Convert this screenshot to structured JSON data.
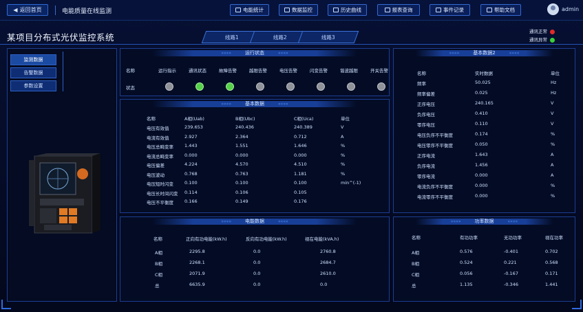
{
  "topbar": {
    "back": "返回首页",
    "title": "电能质量在线监测",
    "nav": [
      "电能统计",
      "数据监控",
      "历史曲线",
      "报表查询",
      "事件记录",
      "帮助文档"
    ],
    "user": "admin"
  },
  "system": {
    "title": "某项目分布式光伏监控系统",
    "tabs": [
      "线路1",
      "线路2",
      "线路3"
    ],
    "legend": [
      {
        "label": "通讯正常",
        "color": "#e52a2a"
      },
      {
        "label": "通讯异常",
        "color": "#3ad13a"
      }
    ]
  },
  "sidebar": {
    "buttons": [
      "监测数据",
      "告警数据",
      "参数设置"
    ]
  },
  "status": {
    "title": "运行状态",
    "row_label": "名称",
    "state_label": "状态",
    "cols": [
      "运行指示",
      "通讯状态",
      "故障告警",
      "越限告警",
      "电压告警",
      "闪变告警",
      "谐波越限",
      "开关告警"
    ],
    "states": [
      false,
      true,
      true,
      false,
      false,
      false,
      false,
      false
    ]
  },
  "basic": {
    "title": "基本数据",
    "headers": [
      "名称",
      "A相(Uab)",
      "B相(Ubc)",
      "C相(Uca)",
      "单位"
    ],
    "rows": [
      [
        "电压有效值",
        "239.653",
        "240.436",
        "240.389",
        "V"
      ],
      [
        "电流有效值",
        "2.927",
        "2.364",
        "0.712",
        "A"
      ],
      [
        "电压总畸变率",
        "1.443",
        "1.551",
        "1.646",
        "%"
      ],
      [
        "电流总畸变率",
        "0.000",
        "0.000",
        "0.000",
        "%"
      ],
      [
        "电压偏差",
        "4.224",
        "4.570",
        "4.510",
        "%"
      ],
      [
        "电压波动",
        "0.768",
        "0.763",
        "1.181",
        "%"
      ],
      [
        "电压短时闪变",
        "0.100",
        "0.100",
        "0.100",
        "min^(-1)"
      ],
      [
        "电压长时间闪变",
        "0.114",
        "0.106",
        "0.105",
        ""
      ],
      [
        "电压不平衡度",
        "0.166",
        "0.149",
        "0.176",
        ""
      ]
    ]
  },
  "right": {
    "title": "基本数据2",
    "headers": [
      "名称",
      "实时数据",
      "单位"
    ],
    "rows": [
      [
        "频率",
        "50.025",
        "Hz"
      ],
      [
        "频率偏差",
        "0.025",
        "Hz"
      ],
      [
        "正序电压",
        "240.165",
        "V"
      ],
      [
        "负序电压",
        "0.410",
        "V"
      ],
      [
        "零序电压",
        "0.110",
        "V"
      ],
      [
        "电压负序不平衡度",
        "0.174",
        "%"
      ],
      [
        "电压零序不平衡度",
        "0.050",
        "%"
      ],
      [
        "正序电流",
        "1.643",
        "A"
      ],
      [
        "负序电流",
        "1.456",
        "A"
      ],
      [
        "零序电流",
        "0.000",
        "A"
      ],
      [
        "电流负序不平衡度",
        "0.000",
        "%"
      ],
      [
        "电流零序不平衡度",
        "0.000",
        "%"
      ]
    ]
  },
  "energy": {
    "title": "电能数据",
    "headers": [
      "名称",
      "正向有功电能(kW.h)",
      "反向有功电能(kW.h)",
      "视在电能(kVA.h)"
    ],
    "rows": [
      [
        "A相",
        "2295.8",
        "0.0",
        "2760.8"
      ],
      [
        "B相",
        "2268.1",
        "0.0",
        "2684.7"
      ],
      [
        "C相",
        "2071.9",
        "0.0",
        "2610.0"
      ],
      [
        "总",
        "6635.9",
        "0.0",
        "0.0"
      ]
    ]
  },
  "power": {
    "title": "功率数据",
    "headers": [
      "名称",
      "有功功率",
      "无功功率",
      "视在功率"
    ],
    "rows": [
      [
        "A相",
        "0.576",
        "-0.401",
        "0.702"
      ],
      [
        "B相",
        "0.524",
        "0.221",
        "0.568"
      ],
      [
        "C相",
        "0.056",
        "-0.167",
        "0.171"
      ],
      [
        "总",
        "1.135",
        "-0.346",
        "1.441"
      ]
    ]
  }
}
